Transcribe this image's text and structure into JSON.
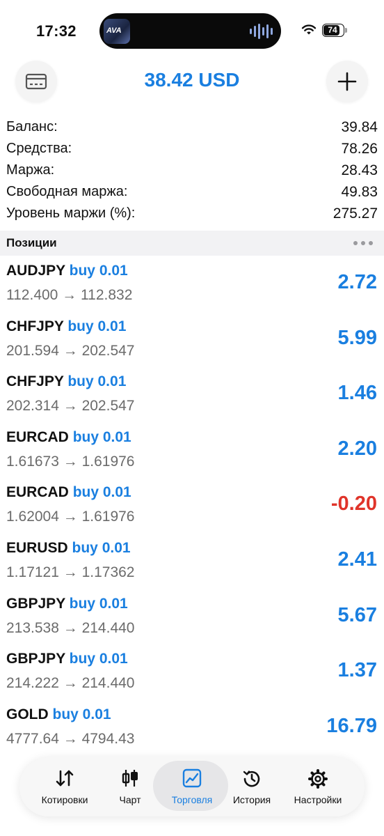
{
  "status_bar": {
    "time": "17:32",
    "battery": "74"
  },
  "header": {
    "title": "38.42 USD"
  },
  "summary": [
    {
      "label": "Баланс:",
      "value": "39.84"
    },
    {
      "label": "Средства:",
      "value": "78.26"
    },
    {
      "label": "Маржа:",
      "value": "28.43"
    },
    {
      "label": "Свободная маржа:",
      "value": "49.83"
    },
    {
      "label": "Уровень маржи (%):",
      "value": "275.27"
    }
  ],
  "positions_section": {
    "title": "Позиции"
  },
  "positions": [
    {
      "symbol": "AUDJPY",
      "side": "buy 0.01",
      "prices": "112.400 → 112.832",
      "profit": "2.72"
    },
    {
      "symbol": "CHFJPY",
      "side": "buy 0.01",
      "prices": "201.594 → 202.547",
      "profit": "5.99"
    },
    {
      "symbol": "CHFJPY",
      "side": "buy 0.01",
      "prices": "202.314 → 202.547",
      "profit": "1.46"
    },
    {
      "symbol": "EURCAD",
      "side": "buy 0.01",
      "prices": "1.61673 → 1.61976",
      "profit": "2.20"
    },
    {
      "symbol": "EURCAD",
      "side": "buy 0.01",
      "prices": "1.62004 → 1.61976",
      "profit": "-0.20"
    },
    {
      "symbol": "EURUSD",
      "side": "buy 0.01",
      "prices": "1.17121 → 1.17362",
      "profit": "2.41"
    },
    {
      "symbol": "GBPJPY",
      "side": "buy 0.01",
      "prices": "213.538 → 214.440",
      "profit": "5.67"
    },
    {
      "symbol": "GBPJPY",
      "side": "buy 0.01",
      "prices": "214.222 → 214.440",
      "profit": "1.37"
    },
    {
      "symbol": "GOLD",
      "side": "buy 0.01",
      "prices": "4777.64 → 4794.43",
      "profit": "16.79"
    }
  ],
  "tabbar": [
    {
      "label": "Котировки",
      "icon": "arrows-up-down-icon"
    },
    {
      "label": "Чарт",
      "icon": "candlestick-icon"
    },
    {
      "label": "Торговля",
      "icon": "trade-chart-icon"
    },
    {
      "label": "История",
      "icon": "history-clock-icon"
    },
    {
      "label": "Настройки",
      "icon": "gear-icon"
    }
  ],
  "colors": {
    "accent": "#1a7fe0",
    "negative": "#e0342a",
    "muted": "#6b6b6b"
  }
}
